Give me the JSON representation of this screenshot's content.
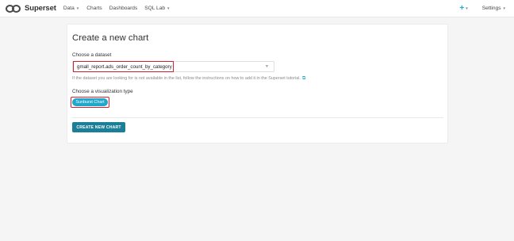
{
  "navbar": {
    "brand": "Superset",
    "items": [
      {
        "label": "Data",
        "has_caret": true
      },
      {
        "label": "Charts",
        "has_caret": false
      },
      {
        "label": "Dashboards",
        "has_caret": false
      },
      {
        "label": "SQL Lab",
        "has_caret": true
      }
    ],
    "plus_icon": "plus-icon",
    "settings": "Settings"
  },
  "form": {
    "title": "Create a new chart",
    "dataset_label": "Choose a dataset",
    "dataset_value": "gmall_report.ads_order_count_by_category",
    "help_text": "If the dataset you are looking for is not available in the list, follow the instructions on how to add it in the Superset tutorial.",
    "viz_label": "Choose a visualization type",
    "viz_selected": "Sunburst Chart",
    "create_button": "CREATE NEW CHART"
  },
  "colors": {
    "accent": "#20a7c9",
    "button": "#1c7f98",
    "highlight": "#d3202f"
  }
}
